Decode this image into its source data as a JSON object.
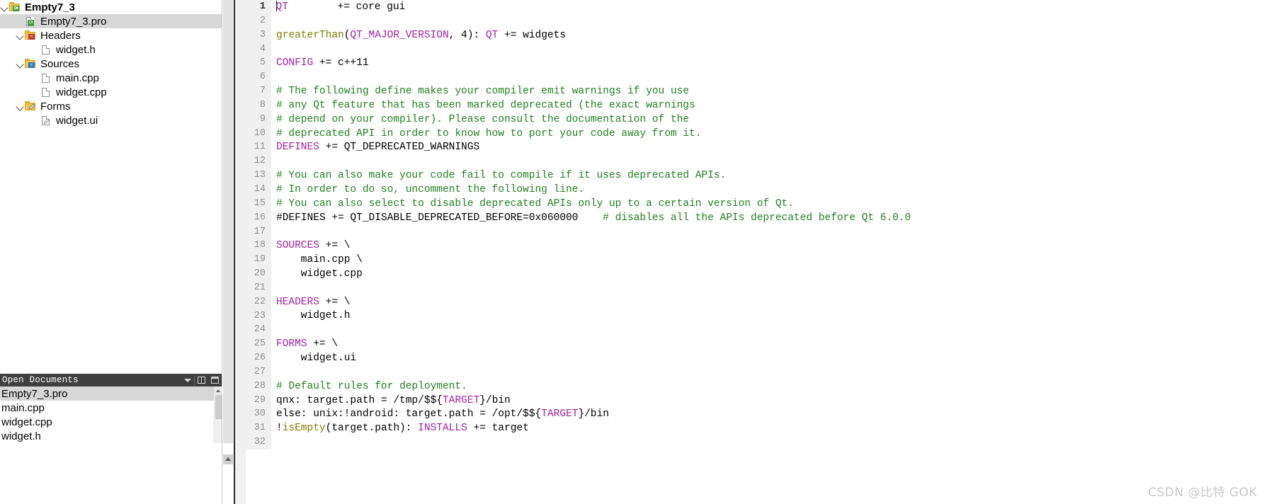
{
  "sidebar": {
    "project_tree": [
      {
        "label": "Empty7_3",
        "indent": 0,
        "twisty": "open",
        "icon": "qt-project-folder-icon",
        "bold": true,
        "selected": false
      },
      {
        "label": "Empty7_3.pro",
        "indent": 1,
        "twisty": "none",
        "icon": "qt-pro-file-icon",
        "bold": false,
        "selected": true
      },
      {
        "label": "Headers",
        "indent": 1,
        "twisty": "open",
        "icon": "headers-folder-icon",
        "bold": false,
        "selected": false
      },
      {
        "label": "widget.h",
        "indent": 2,
        "twisty": "none",
        "icon": "file-icon",
        "bold": false,
        "selected": false
      },
      {
        "label": "Sources",
        "indent": 1,
        "twisty": "open",
        "icon": "sources-folder-icon",
        "bold": false,
        "selected": false
      },
      {
        "label": "main.cpp",
        "indent": 2,
        "twisty": "none",
        "icon": "file-icon",
        "bold": false,
        "selected": false
      },
      {
        "label": "widget.cpp",
        "indent": 2,
        "twisty": "none",
        "icon": "file-icon",
        "bold": false,
        "selected": false
      },
      {
        "label": "Forms",
        "indent": 1,
        "twisty": "open",
        "icon": "forms-folder-icon",
        "bold": false,
        "selected": false
      },
      {
        "label": "widget.ui",
        "indent": 2,
        "twisty": "none",
        "icon": "ui-file-icon",
        "bold": false,
        "selected": false
      }
    ],
    "open_documents": {
      "title": "Open Documents",
      "buttons": [
        "chevron-down-icon",
        "split-icon",
        "close-icon"
      ],
      "items": [
        {
          "label": "Empty7_3.pro",
          "selected": true
        },
        {
          "label": "main.cpp",
          "selected": false
        },
        {
          "label": "widget.cpp",
          "selected": false
        },
        {
          "label": "widget.h",
          "selected": false
        }
      ]
    }
  },
  "editor": {
    "current_line": 1,
    "lines": [
      {
        "n": "1",
        "tokens": [
          {
            "t": "QT",
            "c": "kw"
          },
          {
            "t": "        += core gui",
            "c": ""
          }
        ]
      },
      {
        "n": "2",
        "tokens": []
      },
      {
        "n": "3",
        "tokens": [
          {
            "t": "greaterThan",
            "c": "fn"
          },
          {
            "t": "(",
            "c": ""
          },
          {
            "t": "QT_MAJOR_VERSION",
            "c": "kw"
          },
          {
            "t": ", 4): ",
            "c": ""
          },
          {
            "t": "QT",
            "c": "kw"
          },
          {
            "t": " += widgets",
            "c": ""
          }
        ]
      },
      {
        "n": "4",
        "tokens": []
      },
      {
        "n": "5",
        "tokens": [
          {
            "t": "CONFIG",
            "c": "kw"
          },
          {
            "t": " += c++11",
            "c": ""
          }
        ]
      },
      {
        "n": "6",
        "tokens": []
      },
      {
        "n": "7",
        "tokens": [
          {
            "t": "# The following define makes your compiler emit warnings if you use",
            "c": "cmt"
          }
        ]
      },
      {
        "n": "8",
        "tokens": [
          {
            "t": "# any Qt feature that has been marked deprecated (the exact warnings",
            "c": "cmt"
          }
        ]
      },
      {
        "n": "9",
        "tokens": [
          {
            "t": "# depend on your compiler). Please consult the documentation of the",
            "c": "cmt"
          }
        ]
      },
      {
        "n": "10",
        "tokens": [
          {
            "t": "# deprecated API in order to know how to port your code away from it.",
            "c": "cmt"
          }
        ]
      },
      {
        "n": "11",
        "tokens": [
          {
            "t": "DEFINES",
            "c": "kw"
          },
          {
            "t": " += QT_DEPRECATED_WARNINGS",
            "c": ""
          }
        ]
      },
      {
        "n": "12",
        "tokens": []
      },
      {
        "n": "13",
        "tokens": [
          {
            "t": "# You can also make your code fail to compile if it uses deprecated APIs.",
            "c": "cmt"
          }
        ]
      },
      {
        "n": "14",
        "tokens": [
          {
            "t": "# In order to do so, uncomment the following line.",
            "c": "cmt"
          }
        ]
      },
      {
        "n": "15",
        "tokens": [
          {
            "t": "# You can also select to disable deprecated APIs only up to a certain version of Qt.",
            "c": "cmt"
          }
        ]
      },
      {
        "n": "16",
        "tokens": [
          {
            "t": "#DEFINES += QT_DISABLE_DEPRECATED_BEFORE=0x060000",
            "c": ""
          },
          {
            "t": "    # disables all the APIs deprecated before Qt 6.0.0",
            "c": "cmt"
          }
        ]
      },
      {
        "n": "17",
        "tokens": []
      },
      {
        "n": "18",
        "tokens": [
          {
            "t": "SOURCES",
            "c": "kw"
          },
          {
            "t": " += \\",
            "c": ""
          }
        ]
      },
      {
        "n": "19",
        "tokens": [
          {
            "t": "    main.cpp \\",
            "c": ""
          }
        ]
      },
      {
        "n": "20",
        "tokens": [
          {
            "t": "    widget.cpp",
            "c": ""
          }
        ]
      },
      {
        "n": "21",
        "tokens": []
      },
      {
        "n": "22",
        "tokens": [
          {
            "t": "HEADERS",
            "c": "kw"
          },
          {
            "t": " += \\",
            "c": ""
          }
        ]
      },
      {
        "n": "23",
        "tokens": [
          {
            "t": "    widget.h",
            "c": ""
          }
        ]
      },
      {
        "n": "24",
        "tokens": []
      },
      {
        "n": "25",
        "tokens": [
          {
            "t": "FORMS",
            "c": "kw"
          },
          {
            "t": " += \\",
            "c": ""
          }
        ]
      },
      {
        "n": "26",
        "tokens": [
          {
            "t": "    widget.ui",
            "c": ""
          }
        ]
      },
      {
        "n": "27",
        "tokens": []
      },
      {
        "n": "28",
        "tokens": [
          {
            "t": "# Default rules for deployment.",
            "c": "cmt"
          }
        ]
      },
      {
        "n": "29",
        "tokens": [
          {
            "t": "qnx: target.path = /tmp/$${",
            "c": ""
          },
          {
            "t": "TARGET",
            "c": "var"
          },
          {
            "t": "}/bin",
            "c": ""
          }
        ]
      },
      {
        "n": "30",
        "tokens": [
          {
            "t": "else: unix:!android: target.path = /opt/$${",
            "c": ""
          },
          {
            "t": "TARGET",
            "c": "var"
          },
          {
            "t": "}/bin",
            "c": ""
          }
        ]
      },
      {
        "n": "31",
        "tokens": [
          {
            "t": "!",
            "c": ""
          },
          {
            "t": "isEmpty",
            "c": "fn"
          },
          {
            "t": "(target.path): ",
            "c": ""
          },
          {
            "t": "INSTALLS",
            "c": "kw"
          },
          {
            "t": " += target",
            "c": ""
          }
        ]
      },
      {
        "n": "32",
        "tokens": []
      }
    ]
  },
  "watermark": "CSDN @比特 GOK",
  "colors": {
    "keyword": "#a020a0",
    "function": "#808000",
    "comment": "#208020",
    "variable": "#a020a0",
    "selection": "#d7d7d7",
    "gutter_bg": "#f0f0f0",
    "panel_header_bg": "#3f3f3f"
  }
}
